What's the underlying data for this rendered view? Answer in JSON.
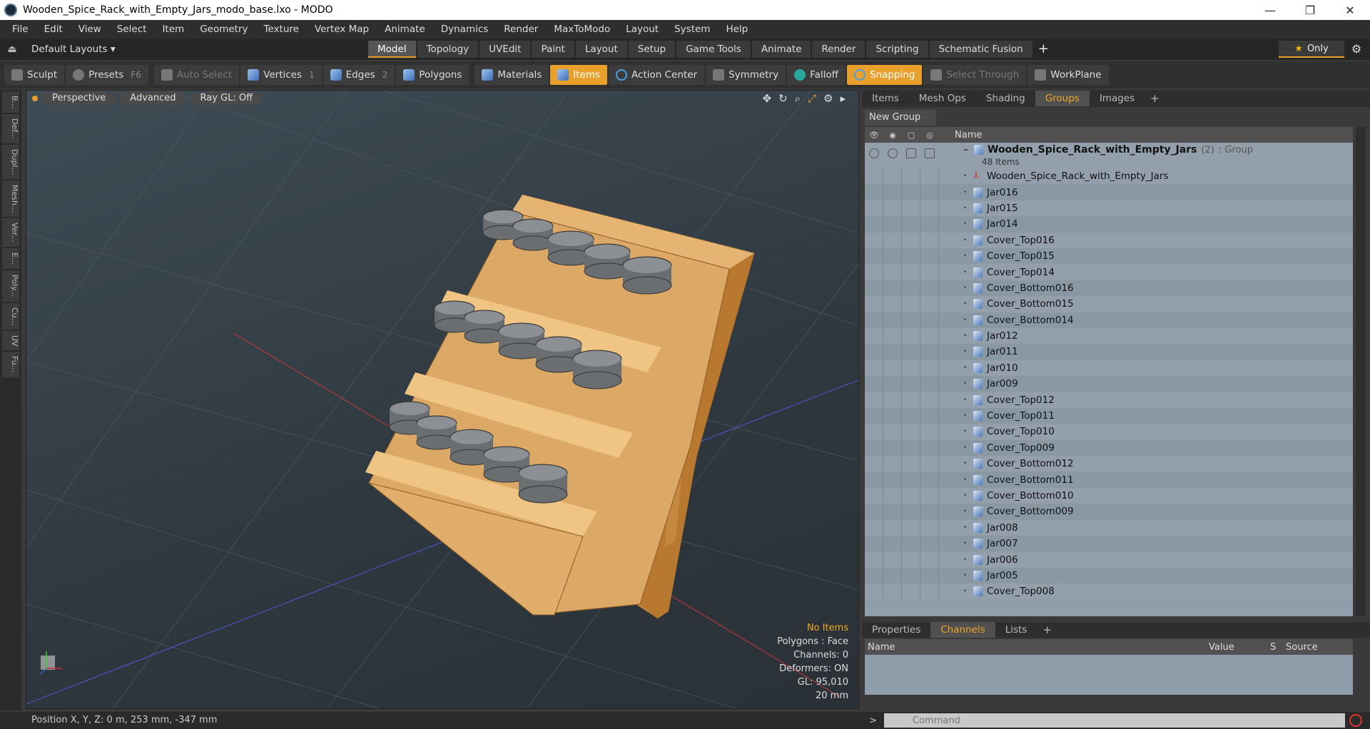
{
  "window": {
    "title": "Wooden_Spice_Rack_with_Empty_Jars_modo_base.lxo - MODO",
    "minimize": "—",
    "restore": "❐",
    "close": "✕"
  },
  "menu": [
    "File",
    "Edit",
    "View",
    "Select",
    "Item",
    "Geometry",
    "Texture",
    "Vertex Map",
    "Animate",
    "Dynamics",
    "Render",
    "MaxToModo",
    "Layout",
    "System",
    "Help"
  ],
  "layout_bar": {
    "dropdown": "Default Layouts ▾",
    "tabs": [
      "Model",
      "Topology",
      "UVEdit",
      "Paint",
      "Layout",
      "Setup",
      "Game Tools",
      "Animate",
      "Render",
      "Scripting",
      "Schematic Fusion"
    ],
    "active_tab": "Model",
    "plus": "+",
    "only": "Only"
  },
  "toolbar": {
    "sculpt": "Sculpt",
    "presets": "Presets",
    "presets_key": "F6",
    "auto_select": "Auto Select",
    "vertices": "Vertices",
    "vertices_count": "1",
    "edges": "Edges",
    "edges_count": "2",
    "polygons": "Polygons",
    "materials": "Materials",
    "items": "Items",
    "action_center": "Action Center",
    "symmetry": "Symmetry",
    "falloff": "Falloff",
    "snapping": "Snapping",
    "select_through": "Select Through",
    "workplane": "WorkPlane"
  },
  "left_rail": [
    "B...",
    "Def...",
    "Dupl...",
    "Mesh...",
    "Ver...",
    "E...",
    "Poly...",
    "Cu...",
    "UV",
    "Fu..."
  ],
  "viewport": {
    "perspective": "Perspective",
    "advanced": "Advanced",
    "raygl": "Ray GL: Off",
    "info": {
      "items": "No Items",
      "polygons": "Polygons : Face",
      "channels": "Channels: 0",
      "deformers": "Deformers: ON",
      "gl": "GL: 95,010",
      "scale": "20 mm"
    }
  },
  "status": {
    "position": "Position X, Y, Z:   0 m, 253 mm, -347 mm"
  },
  "item_panel": {
    "tabs": [
      "Items",
      "Mesh Ops",
      "Shading",
      "Groups",
      "Images"
    ],
    "active_tab": "Groups",
    "plus": "+",
    "new_group": "New Group",
    "name_header": "Name",
    "group": {
      "name": "Wooden_Spice_Rack_with_Empty_Jars",
      "count": "(2)",
      "type": ": Group",
      "sub": "48 Items"
    },
    "rows": [
      {
        "name": "Wooden_Spice_Rack_with_Empty_Jars",
        "kind": "locator"
      },
      {
        "name": "Jar016",
        "kind": "mesh"
      },
      {
        "name": "Jar015",
        "kind": "mesh"
      },
      {
        "name": "Jar014",
        "kind": "mesh"
      },
      {
        "name": "Cover_Top016",
        "kind": "mesh"
      },
      {
        "name": "Cover_Top015",
        "kind": "mesh"
      },
      {
        "name": "Cover_Top014",
        "kind": "mesh"
      },
      {
        "name": "Cover_Bottom016",
        "kind": "mesh"
      },
      {
        "name": "Cover_Bottom015",
        "kind": "mesh"
      },
      {
        "name": "Cover_Bottom014",
        "kind": "mesh"
      },
      {
        "name": "Jar012",
        "kind": "mesh"
      },
      {
        "name": "Jar011",
        "kind": "mesh"
      },
      {
        "name": "Jar010",
        "kind": "mesh"
      },
      {
        "name": "Jar009",
        "kind": "mesh"
      },
      {
        "name": "Cover_Top012",
        "kind": "mesh"
      },
      {
        "name": "Cover_Top011",
        "kind": "mesh"
      },
      {
        "name": "Cover_Top010",
        "kind": "mesh"
      },
      {
        "name": "Cover_Top009",
        "kind": "mesh"
      },
      {
        "name": "Cover_Bottom012",
        "kind": "mesh"
      },
      {
        "name": "Cover_Bottom011",
        "kind": "mesh"
      },
      {
        "name": "Cover_Bottom010",
        "kind": "mesh"
      },
      {
        "name": "Cover_Bottom009",
        "kind": "mesh"
      },
      {
        "name": "Jar008",
        "kind": "mesh"
      },
      {
        "name": "Jar007",
        "kind": "mesh"
      },
      {
        "name": "Jar006",
        "kind": "mesh"
      },
      {
        "name": "Jar005",
        "kind": "mesh"
      },
      {
        "name": "Cover_Top008",
        "kind": "mesh"
      }
    ]
  },
  "channels_panel": {
    "tabs": [
      "Properties",
      "Channels",
      "Lists"
    ],
    "active_tab": "Channels",
    "plus": "+",
    "columns": [
      "Name",
      "Value",
      "S",
      "Source"
    ]
  },
  "command": {
    "placeholder": "Command"
  },
  "colors": {
    "accent": "#e8a02a",
    "list_bg": "#8f9eaa",
    "wood": "#d9a25a"
  }
}
